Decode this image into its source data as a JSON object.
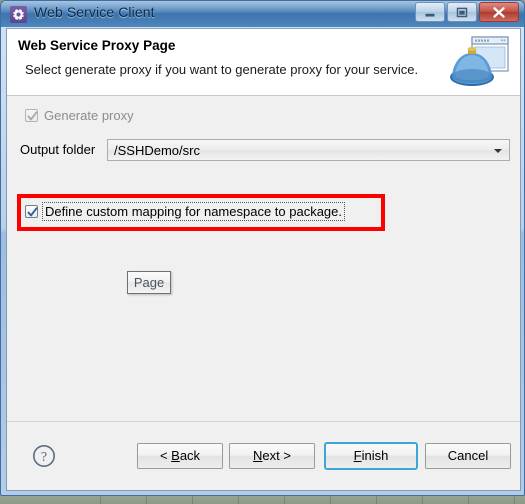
{
  "window": {
    "title": "Web Service Client",
    "app_icon": "gear-icon",
    "controls": {
      "minimize": "minimize-icon",
      "maximize": "restore-icon",
      "close": "close-icon"
    }
  },
  "wizard": {
    "title": "Web Service Proxy Page",
    "description": "Select generate proxy if you want to generate proxy for your service.",
    "banner_icon": "web-service-server-icon"
  },
  "form": {
    "generate_proxy": {
      "label": "Generate proxy",
      "checked": true,
      "enabled": false
    },
    "output_folder": {
      "label": "Output folder",
      "value": "/SSHDemo/src",
      "arrow_icon": "chevron-down-icon"
    },
    "define_mapping": {
      "label": "Define custom mapping for namespace to package.",
      "checked": true,
      "enabled": true,
      "focused": true
    },
    "page_button": {
      "label": "Page"
    }
  },
  "annotation": {
    "highlight_color": "#ff0000"
  },
  "footer": {
    "help_icon": "help-question-icon",
    "buttons": {
      "back_prefix": "< ",
      "back_accel": "B",
      "back_rest": "ack",
      "next_accel": "N",
      "next_rest": "ext",
      "next_suffix": " >",
      "finish_accel": "F",
      "finish_rest": "inish",
      "cancel": "Cancel"
    }
  },
  "theme": {
    "title_bar_blue": "#4178b4",
    "default_button_border": "#3ea6d6",
    "dialog_background": "#f0f0f0"
  }
}
